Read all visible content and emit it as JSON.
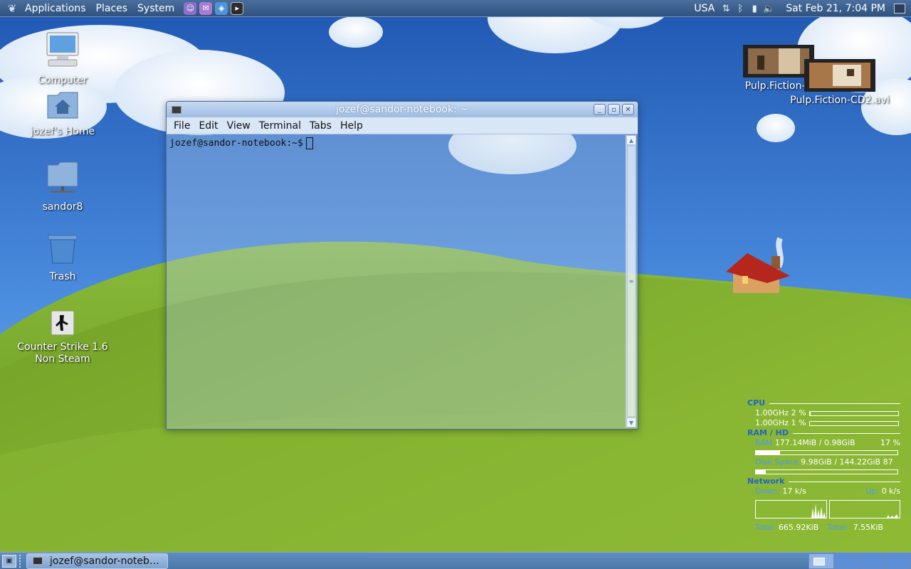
{
  "top_panel": {
    "menus": [
      "Applications",
      "Places",
      "System"
    ],
    "launchers": [
      "pidgin-icon",
      "pidgin-icon",
      "virtualbox-icon",
      "terminal-icon"
    ],
    "keyboard_layout": "USA",
    "clock": "Sat Feb 21,  7:04 PM"
  },
  "desktop_icons": [
    {
      "label": "Computer",
      "icon": "computer-icon"
    },
    {
      "label": "jozef's Home",
      "icon": "home-folder-icon"
    },
    {
      "label": "sandor8",
      "icon": "network-folder-icon"
    },
    {
      "label": "Trash",
      "icon": "trash-icon"
    },
    {
      "label": "Counter Strike 1.6\nNon Steam",
      "icon": "counter-strike-icon"
    }
  ],
  "video_files": [
    {
      "label": "Pulp.Fiction-C"
    },
    {
      "label": "Pulp.Fiction-CD2.avi"
    }
  ],
  "terminal": {
    "title": "jozef@sandor-notebook: ~",
    "menu": [
      "File",
      "Edit",
      "View",
      "Terminal",
      "Tabs",
      "Help"
    ],
    "prompt": "jozef@sandor-notebook:~$"
  },
  "conky": {
    "cpu_header": "CPU",
    "cpu_rows": [
      {
        "label": "1.00GHz 2",
        "unit": "%",
        "value": 0.01
      },
      {
        "label": "1.00GHz 1",
        "unit": "%",
        "value": 0.0
      }
    ],
    "ram_header": "RAM / HD",
    "ram_label": "RAM",
    "ram_value": "177.14MiB / 0.98GiB",
    "ram_percent": "17 %",
    "ram_fraction": 0.17,
    "disk_label": "Disk Space",
    "disk_value": "9.98GiB  / 144.22GiB 87",
    "disk_fraction": 0.07,
    "net_header": "Network",
    "down_label": "Down:",
    "down_value": "17  k/s",
    "up_label": "Up:",
    "up_value": "0   k/s",
    "total_label": "Total:",
    "total_down": "665.92KiB",
    "total_up": "7.55KiB"
  },
  "bottom_panel": {
    "task_title": "jozef@sandor-noteb…",
    "workspaces": 4,
    "active_workspace": 1
  },
  "colors": {
    "sky": "#3f7fd0",
    "hill": "#7aa832",
    "panel": "#3a5f8d",
    "conky_header": "#1f66c8"
  }
}
